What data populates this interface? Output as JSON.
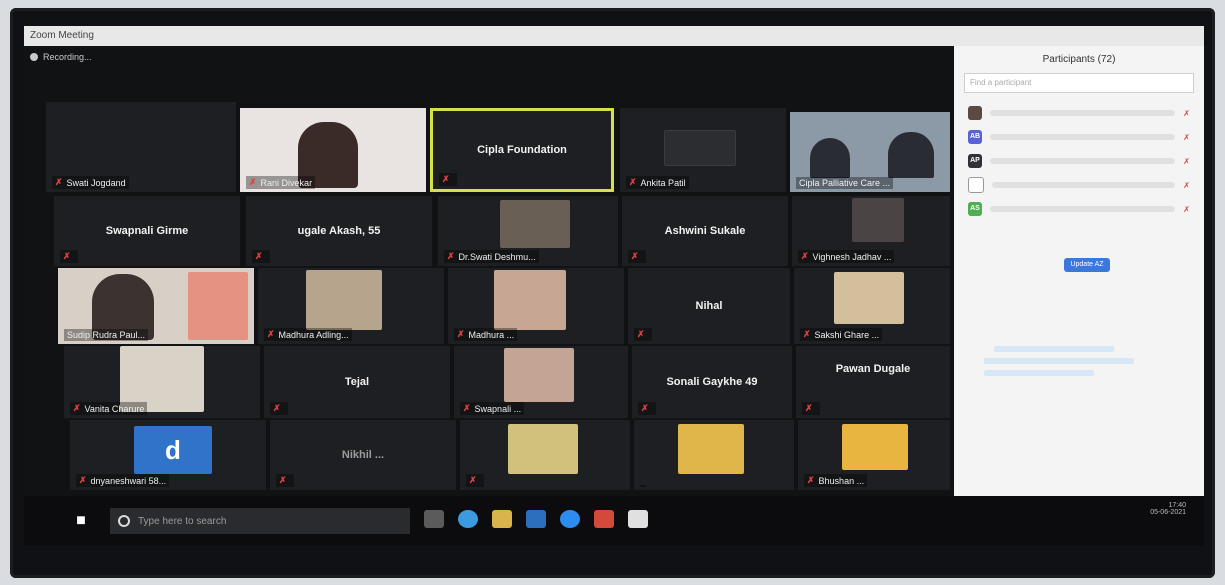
{
  "window": {
    "title": "Zoom Meeting"
  },
  "recording": {
    "label": "Recording..."
  },
  "participants_panel": {
    "title": "Participants (72)",
    "search_placeholder": "Find a participant",
    "admit_label": "Update AZ"
  },
  "tiles": [
    {
      "name": "Swati Jogdand",
      "center": ""
    },
    {
      "name": "Rani Divekar",
      "center": ""
    },
    {
      "name": "",
      "center": "Cipla Foundation",
      "highlight": true
    },
    {
      "name": "Ankita Patil",
      "center": ""
    },
    {
      "name": "Cipla Palliative Care ...",
      "center": ""
    },
    {
      "name": "",
      "center": "Swapnali Girme"
    },
    {
      "name": "",
      "center": "ugale Akash, 55"
    },
    {
      "name": "Dr.Swati Deshmu...",
      "center": ""
    },
    {
      "name": "",
      "center": "Ashwini Sukale"
    },
    {
      "name": "Vighnesh Jadhav ...",
      "center": ""
    },
    {
      "name": "Sudip Rudra Paul...",
      "center": ""
    },
    {
      "name": "Madhura Adling...",
      "center": ""
    },
    {
      "name": "Madhura ...",
      "center": ""
    },
    {
      "name": "",
      "center": "Nihal"
    },
    {
      "name": "Sakshi Ghare ...",
      "center": ""
    },
    {
      "name": "Vanita Charure",
      "center": ""
    },
    {
      "name": "",
      "center": "Tejal"
    },
    {
      "name": "Swapnali ...",
      "center": ""
    },
    {
      "name": "",
      "center": "Sonali Gaykhe 49"
    },
    {
      "name": "",
      "center": "Pawan Dugale"
    },
    {
      "name": "dnyaneshwari 58...",
      "center": ""
    },
    {
      "name": "",
      "center": "Nikhil ..."
    },
    {
      "name": "",
      "center": ""
    },
    {
      "name": "",
      "center": ""
    },
    {
      "name": "Bhushan ...",
      "center": ""
    }
  ],
  "taskbar": {
    "search_placeholder": "Type here to search",
    "time": "17:40",
    "date": "05-06-2021"
  },
  "colors": {
    "highlight": "#d6e04b",
    "zoom_blue": "#3a78e0"
  }
}
